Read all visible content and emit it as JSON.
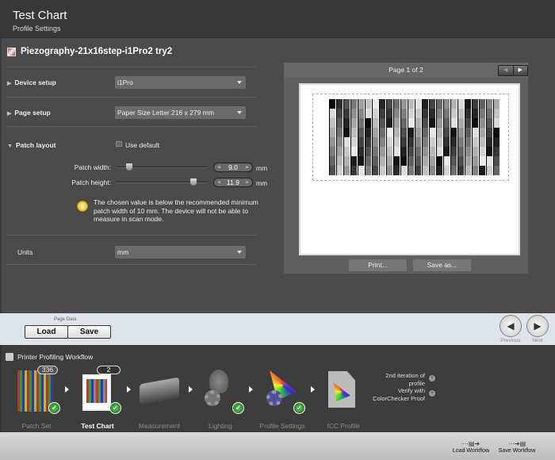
{
  "header": {
    "title": "Test Chart",
    "subtitle": "Profile Settings"
  },
  "document": {
    "title": "Piezography-21x16step-i1Pro2 try2"
  },
  "settings": {
    "device_setup": {
      "label": "Device setup",
      "value": "i1Pro"
    },
    "page_setup": {
      "label": "Page setup",
      "value": "Paper Size Letter  216 x 279 mm"
    },
    "patch_layout": {
      "label": "Patch layout",
      "use_default_label": "Use default",
      "use_default_checked": false,
      "patch_width": {
        "label": "Patch width:",
        "value": "9.0",
        "unit": "mm",
        "slider_fraction": 0.12
      },
      "patch_height": {
        "label": "Patch height:",
        "value": "11.9",
        "unit": "mm",
        "slider_fraction": 0.88
      },
      "warning": "The chosen value is below the recommended minimum patch width of 10 mm. The device will not be able to measure in scan mode."
    },
    "units": {
      "label": "Units",
      "value": "mm"
    }
  },
  "preview": {
    "page_indicator": "Page 1 of 2",
    "print_label": "Print...",
    "save_as_label": "Save as..."
  },
  "page_data": {
    "label": "Page Data",
    "load": "Load",
    "save": "Save"
  },
  "navigation": {
    "previous": "Previous",
    "next": "Next"
  },
  "workflow": {
    "title": "Printer Profiling Workflow",
    "steps": [
      {
        "label": "Patch Set",
        "badge": "336",
        "done": true
      },
      {
        "label": "Test Chart",
        "badge": "2",
        "done": true,
        "active": true
      },
      {
        "label": "Measurement",
        "done": false
      },
      {
        "label": "Lighting",
        "done": true
      },
      {
        "label": "Profile Settings",
        "done": true
      },
      {
        "label": "ICC Profile",
        "done": false
      }
    ],
    "side": {
      "second_iteration": "2nd iteration of profile",
      "verify": "Verify with ColorChecker Proof"
    }
  },
  "footer": {
    "load_workflow": "Load Workflow",
    "save_workflow": "Save Workflow"
  },
  "colors": {
    "check": "#2e8b2e",
    "bottom_bar": "#dfe3ea",
    "warning": "#e0b000"
  }
}
